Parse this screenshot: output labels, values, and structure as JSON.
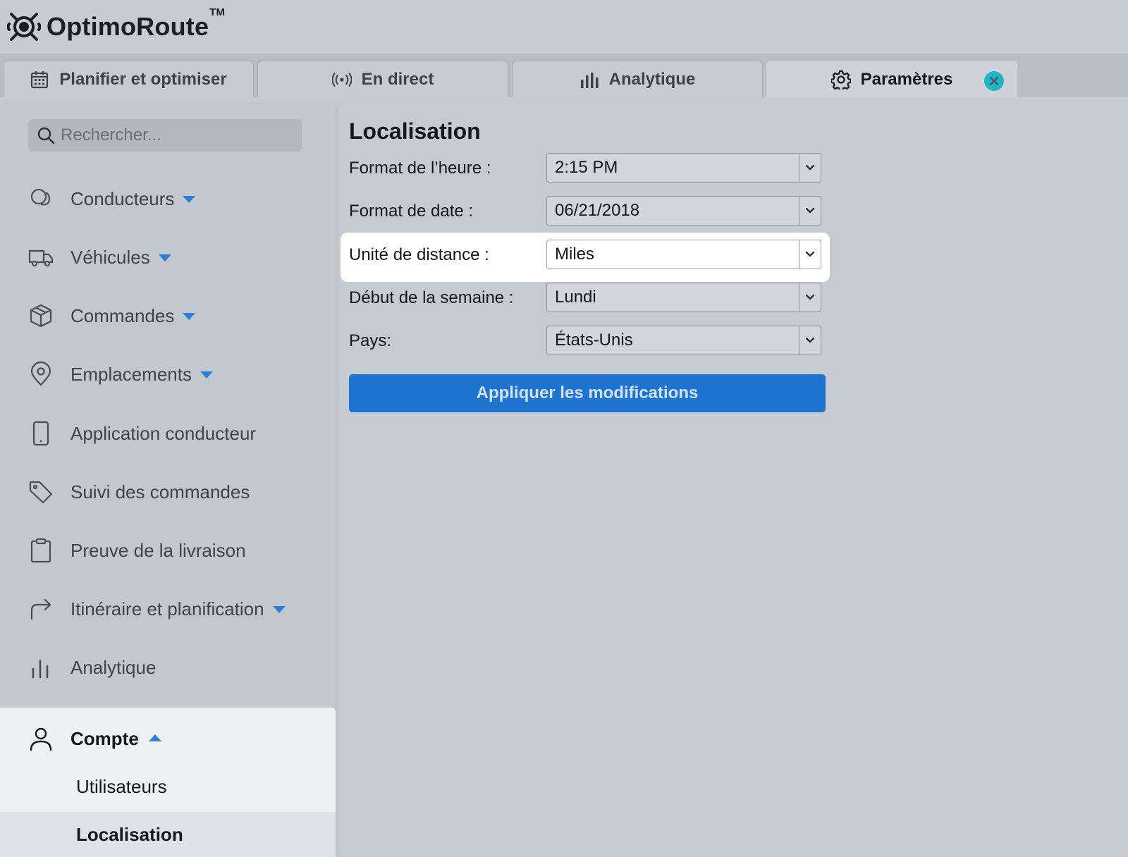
{
  "app": {
    "name": "OptimoRoute",
    "trademark": "TM"
  },
  "tabs": [
    {
      "label": "Planifier et optimiser",
      "icon": "calendar-icon"
    },
    {
      "label": "En direct",
      "icon": "broadcast-icon"
    },
    {
      "label": "Analytique",
      "icon": "bar-chart-icon"
    },
    {
      "label": "Paramètres",
      "icon": "gear-icon",
      "active": true
    }
  ],
  "sidebar": {
    "search_placeholder": "Rechercher...",
    "items": [
      {
        "label": "Conducteurs",
        "icon": "drivers-icon",
        "expandable": true
      },
      {
        "label": "Véhicules",
        "icon": "truck-icon",
        "expandable": true
      },
      {
        "label": "Commandes",
        "icon": "box-icon",
        "expandable": true
      },
      {
        "label": "Emplacements",
        "icon": "location-pin-icon",
        "expandable": true
      },
      {
        "label": "Application conducteur",
        "icon": "phone-icon",
        "expandable": false
      },
      {
        "label": "Suivi des commandes",
        "icon": "tag-icon",
        "expandable": false
      },
      {
        "label": "Preuve de la livraison",
        "icon": "clipboard-icon",
        "expandable": false
      },
      {
        "label": "Itinéraire et planification",
        "icon": "route-arrow-icon",
        "expandable": true
      },
      {
        "label": "Analytique",
        "icon": "bar-chart-icon",
        "expandable": false
      }
    ],
    "account": {
      "label": "Compte",
      "icon": "user-icon",
      "expanded": true,
      "subitems": [
        {
          "label": "Utilisateurs",
          "selected": false
        },
        {
          "label": "Localisation",
          "selected": true
        }
      ]
    }
  },
  "main": {
    "title": "Localisation",
    "fields": [
      {
        "label": "Format de l’heure :",
        "value": "2:15 PM",
        "highlighted": false
      },
      {
        "label": "Format de date :",
        "value": "06/21/2018",
        "highlighted": false
      },
      {
        "label": "Unité de distance :",
        "value": "Miles",
        "highlighted": true
      },
      {
        "label": "Début de la semaine :",
        "value": "Lundi",
        "highlighted": false
      },
      {
        "label": "Pays:",
        "value": "États-Unis",
        "highlighted": false
      }
    ],
    "apply_label": "Appliquer les modifications"
  },
  "colors": {
    "accent": "#1e74d0",
    "caret": "#2b7fd6",
    "close_button": "#1fb6c9",
    "background": "#c6cad1",
    "highlight": "#ffffff"
  }
}
